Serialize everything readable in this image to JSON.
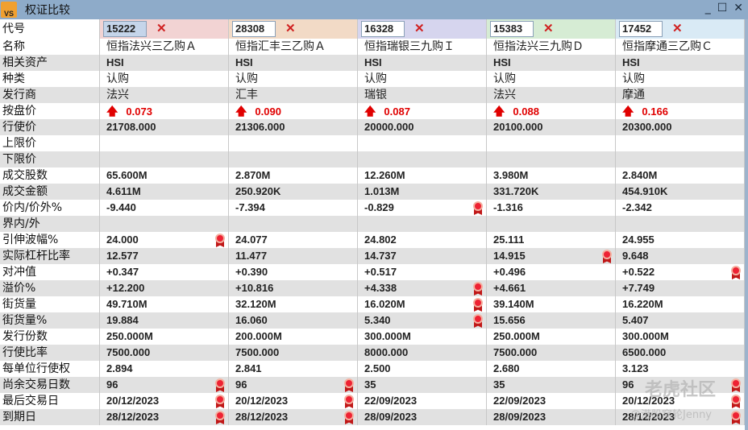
{
  "window": {
    "title": "权证比较",
    "logo": "VS"
  },
  "columns": [
    {
      "code": "15222",
      "color": "#f2d3d3"
    },
    {
      "code": "28308",
      "color": "#f2dac6"
    },
    {
      "code": "16328",
      "color": "#d6d5ee"
    },
    {
      "code": "15383",
      "color": "#d6ecd4"
    },
    {
      "code": "17452",
      "color": "#d9eaf5"
    }
  ],
  "code_label": "代号",
  "rows": [
    {
      "label": "名称",
      "type": "cn",
      "cells": [
        {
          "v": "恒指法兴三乙购Ａ"
        },
        {
          "v": "恒指汇丰三乙购Ａ"
        },
        {
          "v": "恒指瑞银三九购Ｉ"
        },
        {
          "v": "恒指法兴三九购Ｄ"
        },
        {
          "v": "恒指摩通三乙购Ｃ"
        }
      ]
    },
    {
      "label": "相关资产",
      "cells": [
        {
          "v": "HSI"
        },
        {
          "v": "HSI"
        },
        {
          "v": "HSI"
        },
        {
          "v": "HSI"
        },
        {
          "v": "HSI"
        }
      ]
    },
    {
      "label": "种类",
      "type": "cn",
      "cells": [
        {
          "v": "认购"
        },
        {
          "v": "认购"
        },
        {
          "v": "认购"
        },
        {
          "v": "认购"
        },
        {
          "v": "认购"
        }
      ]
    },
    {
      "label": "发行商",
      "type": "cn",
      "cells": [
        {
          "v": "法兴"
        },
        {
          "v": "汇丰"
        },
        {
          "v": "瑞银"
        },
        {
          "v": "法兴"
        },
        {
          "v": "摩通"
        }
      ]
    },
    {
      "label": "按盘价",
      "type": "price",
      "cells": [
        {
          "v": "0.073"
        },
        {
          "v": "0.090"
        },
        {
          "v": "0.087"
        },
        {
          "v": "0.088"
        },
        {
          "v": "0.166"
        }
      ]
    },
    {
      "label": "行使价",
      "cells": [
        {
          "v": "21708.000"
        },
        {
          "v": "21306.000"
        },
        {
          "v": "20000.000"
        },
        {
          "v": "20100.000"
        },
        {
          "v": "20300.000"
        }
      ]
    },
    {
      "label": "上限价",
      "cells": [
        {
          "v": ""
        },
        {
          "v": ""
        },
        {
          "v": ""
        },
        {
          "v": ""
        },
        {
          "v": ""
        }
      ]
    },
    {
      "label": "下限价",
      "cells": [
        {
          "v": ""
        },
        {
          "v": ""
        },
        {
          "v": ""
        },
        {
          "v": ""
        },
        {
          "v": ""
        }
      ]
    },
    {
      "label": "成交股数",
      "cells": [
        {
          "v": "65.600M"
        },
        {
          "v": "2.870M"
        },
        {
          "v": "12.260M"
        },
        {
          "v": "3.980M"
        },
        {
          "v": "2.840M"
        }
      ]
    },
    {
      "label": "成交金额",
      "cells": [
        {
          "v": "4.611M"
        },
        {
          "v": "250.920K"
        },
        {
          "v": "1.013M"
        },
        {
          "v": "331.720K"
        },
        {
          "v": "454.910K"
        }
      ]
    },
    {
      "label": "价内/价外%",
      "cells": [
        {
          "v": "-9.440"
        },
        {
          "v": "-7.394"
        },
        {
          "v": "-0.829",
          "award": true
        },
        {
          "v": "-1.316"
        },
        {
          "v": "-2.342"
        }
      ]
    },
    {
      "label": "界内/外",
      "cells": [
        {
          "v": ""
        },
        {
          "v": ""
        },
        {
          "v": ""
        },
        {
          "v": ""
        },
        {
          "v": ""
        }
      ]
    },
    {
      "label": "引伸波幅%",
      "cells": [
        {
          "v": "24.000",
          "award": true
        },
        {
          "v": "24.077"
        },
        {
          "v": "24.802"
        },
        {
          "v": "25.111"
        },
        {
          "v": "24.955"
        }
      ]
    },
    {
      "label": "实际杠杆比率",
      "cells": [
        {
          "v": "12.577"
        },
        {
          "v": "11.477"
        },
        {
          "v": "14.737"
        },
        {
          "v": "14.915",
          "award": true
        },
        {
          "v": "9.648"
        }
      ]
    },
    {
      "label": "对冲值",
      "cells": [
        {
          "v": "+0.347"
        },
        {
          "v": "+0.390"
        },
        {
          "v": "+0.517"
        },
        {
          "v": "+0.496"
        },
        {
          "v": "+0.522",
          "award": true
        }
      ]
    },
    {
      "label": "溢价%",
      "cells": [
        {
          "v": "+12.200"
        },
        {
          "v": "+10.816"
        },
        {
          "v": "+4.338",
          "award": true
        },
        {
          "v": "+4.661"
        },
        {
          "v": "+7.749"
        }
      ]
    },
    {
      "label": "街货量",
      "cells": [
        {
          "v": "49.710M"
        },
        {
          "v": "32.120M"
        },
        {
          "v": "16.020M",
          "award": true
        },
        {
          "v": "39.140M"
        },
        {
          "v": "16.220M"
        }
      ]
    },
    {
      "label": "街货量%",
      "cells": [
        {
          "v": "19.884"
        },
        {
          "v": "16.060"
        },
        {
          "v": "5.340",
          "award": true
        },
        {
          "v": "15.656"
        },
        {
          "v": "5.407"
        }
      ]
    },
    {
      "label": "发行份数",
      "cells": [
        {
          "v": "250.000M"
        },
        {
          "v": "200.000M"
        },
        {
          "v": "300.000M"
        },
        {
          "v": "250.000M"
        },
        {
          "v": "300.000M"
        }
      ]
    },
    {
      "label": "行使比率",
      "cells": [
        {
          "v": "7500.000"
        },
        {
          "v": "7500.000"
        },
        {
          "v": "8000.000"
        },
        {
          "v": "7500.000"
        },
        {
          "v": "6500.000"
        }
      ]
    },
    {
      "label": "每单位行使权",
      "cells": [
        {
          "v": "2.894"
        },
        {
          "v": "2.841"
        },
        {
          "v": "2.500"
        },
        {
          "v": "2.680"
        },
        {
          "v": "3.123"
        }
      ]
    },
    {
      "label": "尚余交易日数",
      "cells": [
        {
          "v": "96",
          "award": true
        },
        {
          "v": "96",
          "award": true
        },
        {
          "v": "35"
        },
        {
          "v": "35"
        },
        {
          "v": "96",
          "award": true
        }
      ]
    },
    {
      "label": "最后交易日",
      "cells": [
        {
          "v": "20/12/2023",
          "award": true
        },
        {
          "v": "20/12/2023",
          "award": true
        },
        {
          "v": "22/09/2023"
        },
        {
          "v": "22/09/2023"
        },
        {
          "v": "20/12/2023",
          "award": true
        }
      ]
    },
    {
      "label": "到期日",
      "cells": [
        {
          "v": "28/12/2023",
          "award": true
        },
        {
          "v": "28/12/2023",
          "award": true
        },
        {
          "v": "28/09/2023"
        },
        {
          "v": "28/09/2023"
        },
        {
          "v": "28/12/2023",
          "award": true
        }
      ]
    }
  ],
  "colors": {
    "price_up": "#e00000",
    "titlebar": "#8eabc9"
  },
  "watermark": {
    "brand": "老虎社区",
    "author": "@港股窝轮Jenny"
  }
}
